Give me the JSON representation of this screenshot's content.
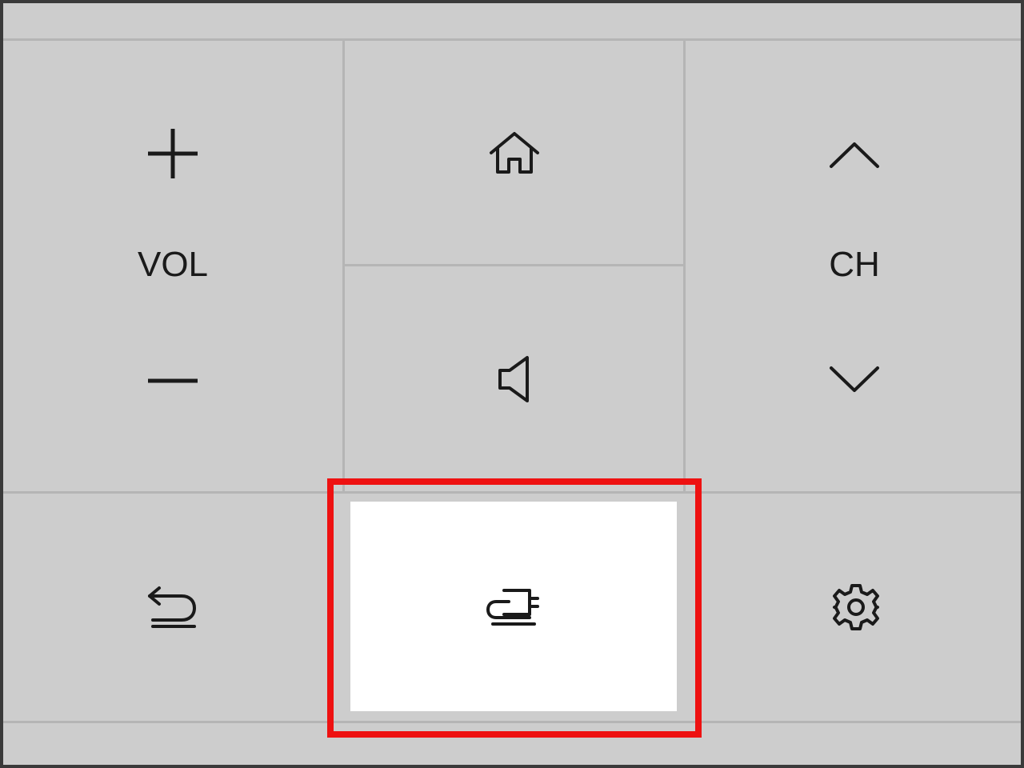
{
  "remote": {
    "volume": {
      "label": "VOL",
      "up_icon": "plus-icon",
      "down_icon": "minus-icon"
    },
    "channel": {
      "label": "CH",
      "up_icon": "chevron-up-icon",
      "down_icon": "chevron-down-icon"
    },
    "home_icon": "home-icon",
    "mute_icon": "speaker-icon",
    "back_icon": "return-icon",
    "input_icon": "input-source-icon",
    "settings_icon": "gear-icon",
    "highlighted_button": "input-source-button"
  },
  "colors": {
    "panel_background": "#cdcdcd",
    "divider": "#b5b5b5",
    "icon_stroke": "#1a1a1a",
    "highlight_outline": "#ee1111",
    "selected_tile": "#ffffff"
  }
}
